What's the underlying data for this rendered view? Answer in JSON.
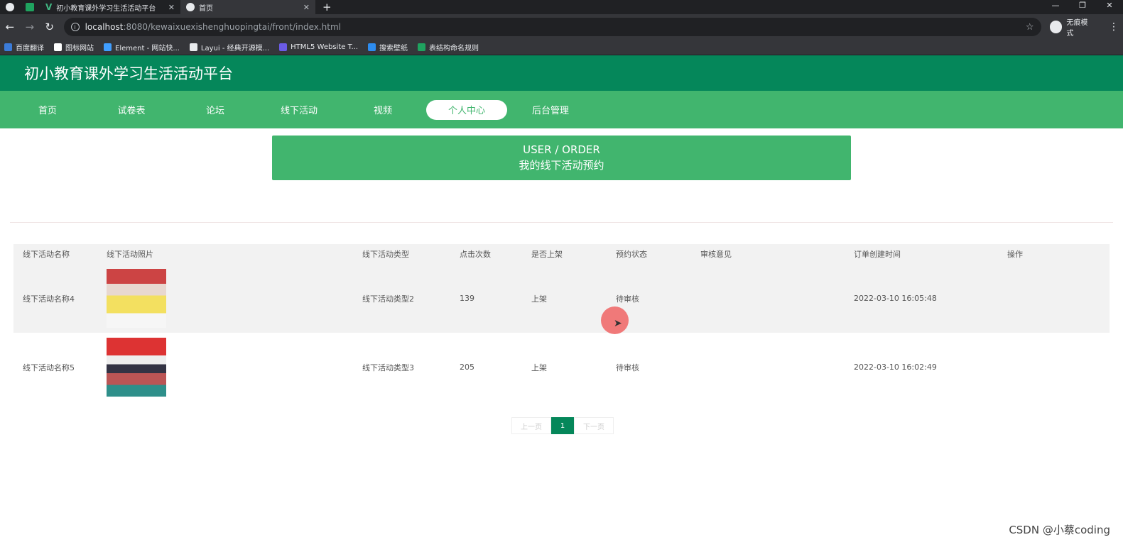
{
  "browser": {
    "tabs": [
      {
        "label": "初小教育课外学习生活活动平台",
        "close": "✕"
      },
      {
        "label": "首页",
        "close": "✕"
      }
    ],
    "new_tab": "+",
    "win_min": "—",
    "win_restore": "❐",
    "win_close": "✕",
    "url_host": "localhost",
    "url_rest": ":8080/kewaixuexishenghuopingtai/front/index.html",
    "incognito_label": "无痕模式",
    "bookmarks": [
      {
        "label": "百度翻译",
        "color": "#3b7bd8"
      },
      {
        "label": "图标网站",
        "color": "#ffffff"
      },
      {
        "label": "Element - 网站快...",
        "color": "#409eff"
      },
      {
        "label": "Layui - 经典开源模...",
        "color": "#e8eaed"
      },
      {
        "label": "HTML5 Website T...",
        "color": "#6b5be6"
      },
      {
        "label": "搜索壁纸",
        "color": "#2d8cf0"
      },
      {
        "label": "表结构命名规则",
        "color": "#1fa35f"
      }
    ]
  },
  "site": {
    "title": "初小教育课外学习生活活动平台",
    "nav": [
      "首页",
      "试卷表",
      "论坛",
      "线下活动",
      "视频",
      "个人中心",
      "后台管理"
    ],
    "active_nav": "个人中心"
  },
  "banner": {
    "en": "USER / ORDER",
    "cn": "我的线下活动预约"
  },
  "table": {
    "headers": [
      "线下活动名称",
      "线下活动照片",
      "线下活动类型",
      "点击次数",
      "是否上架",
      "预约状态",
      "审核意见",
      "订单创建时间",
      "操作"
    ],
    "rows": [
      {
        "name": "线下活动名称4",
        "type": "线下活动类型2",
        "clicks": "139",
        "shelf": "上架",
        "status": "待审核",
        "opinion": "",
        "created": "2022-03-10 16:05:48",
        "ops": ""
      },
      {
        "name": "线下活动名称5",
        "type": "线下活动类型3",
        "clicks": "205",
        "shelf": "上架",
        "status": "待审核",
        "opinion": "",
        "created": "2022-03-10 16:02:49",
        "ops": ""
      }
    ]
  },
  "pager": {
    "prev": "上一页",
    "current": "1",
    "next": "下一页"
  },
  "watermark": "CSDN @小蔡coding",
  "colors": {
    "header_green": "#05875a",
    "nav_green": "#41b56e"
  }
}
